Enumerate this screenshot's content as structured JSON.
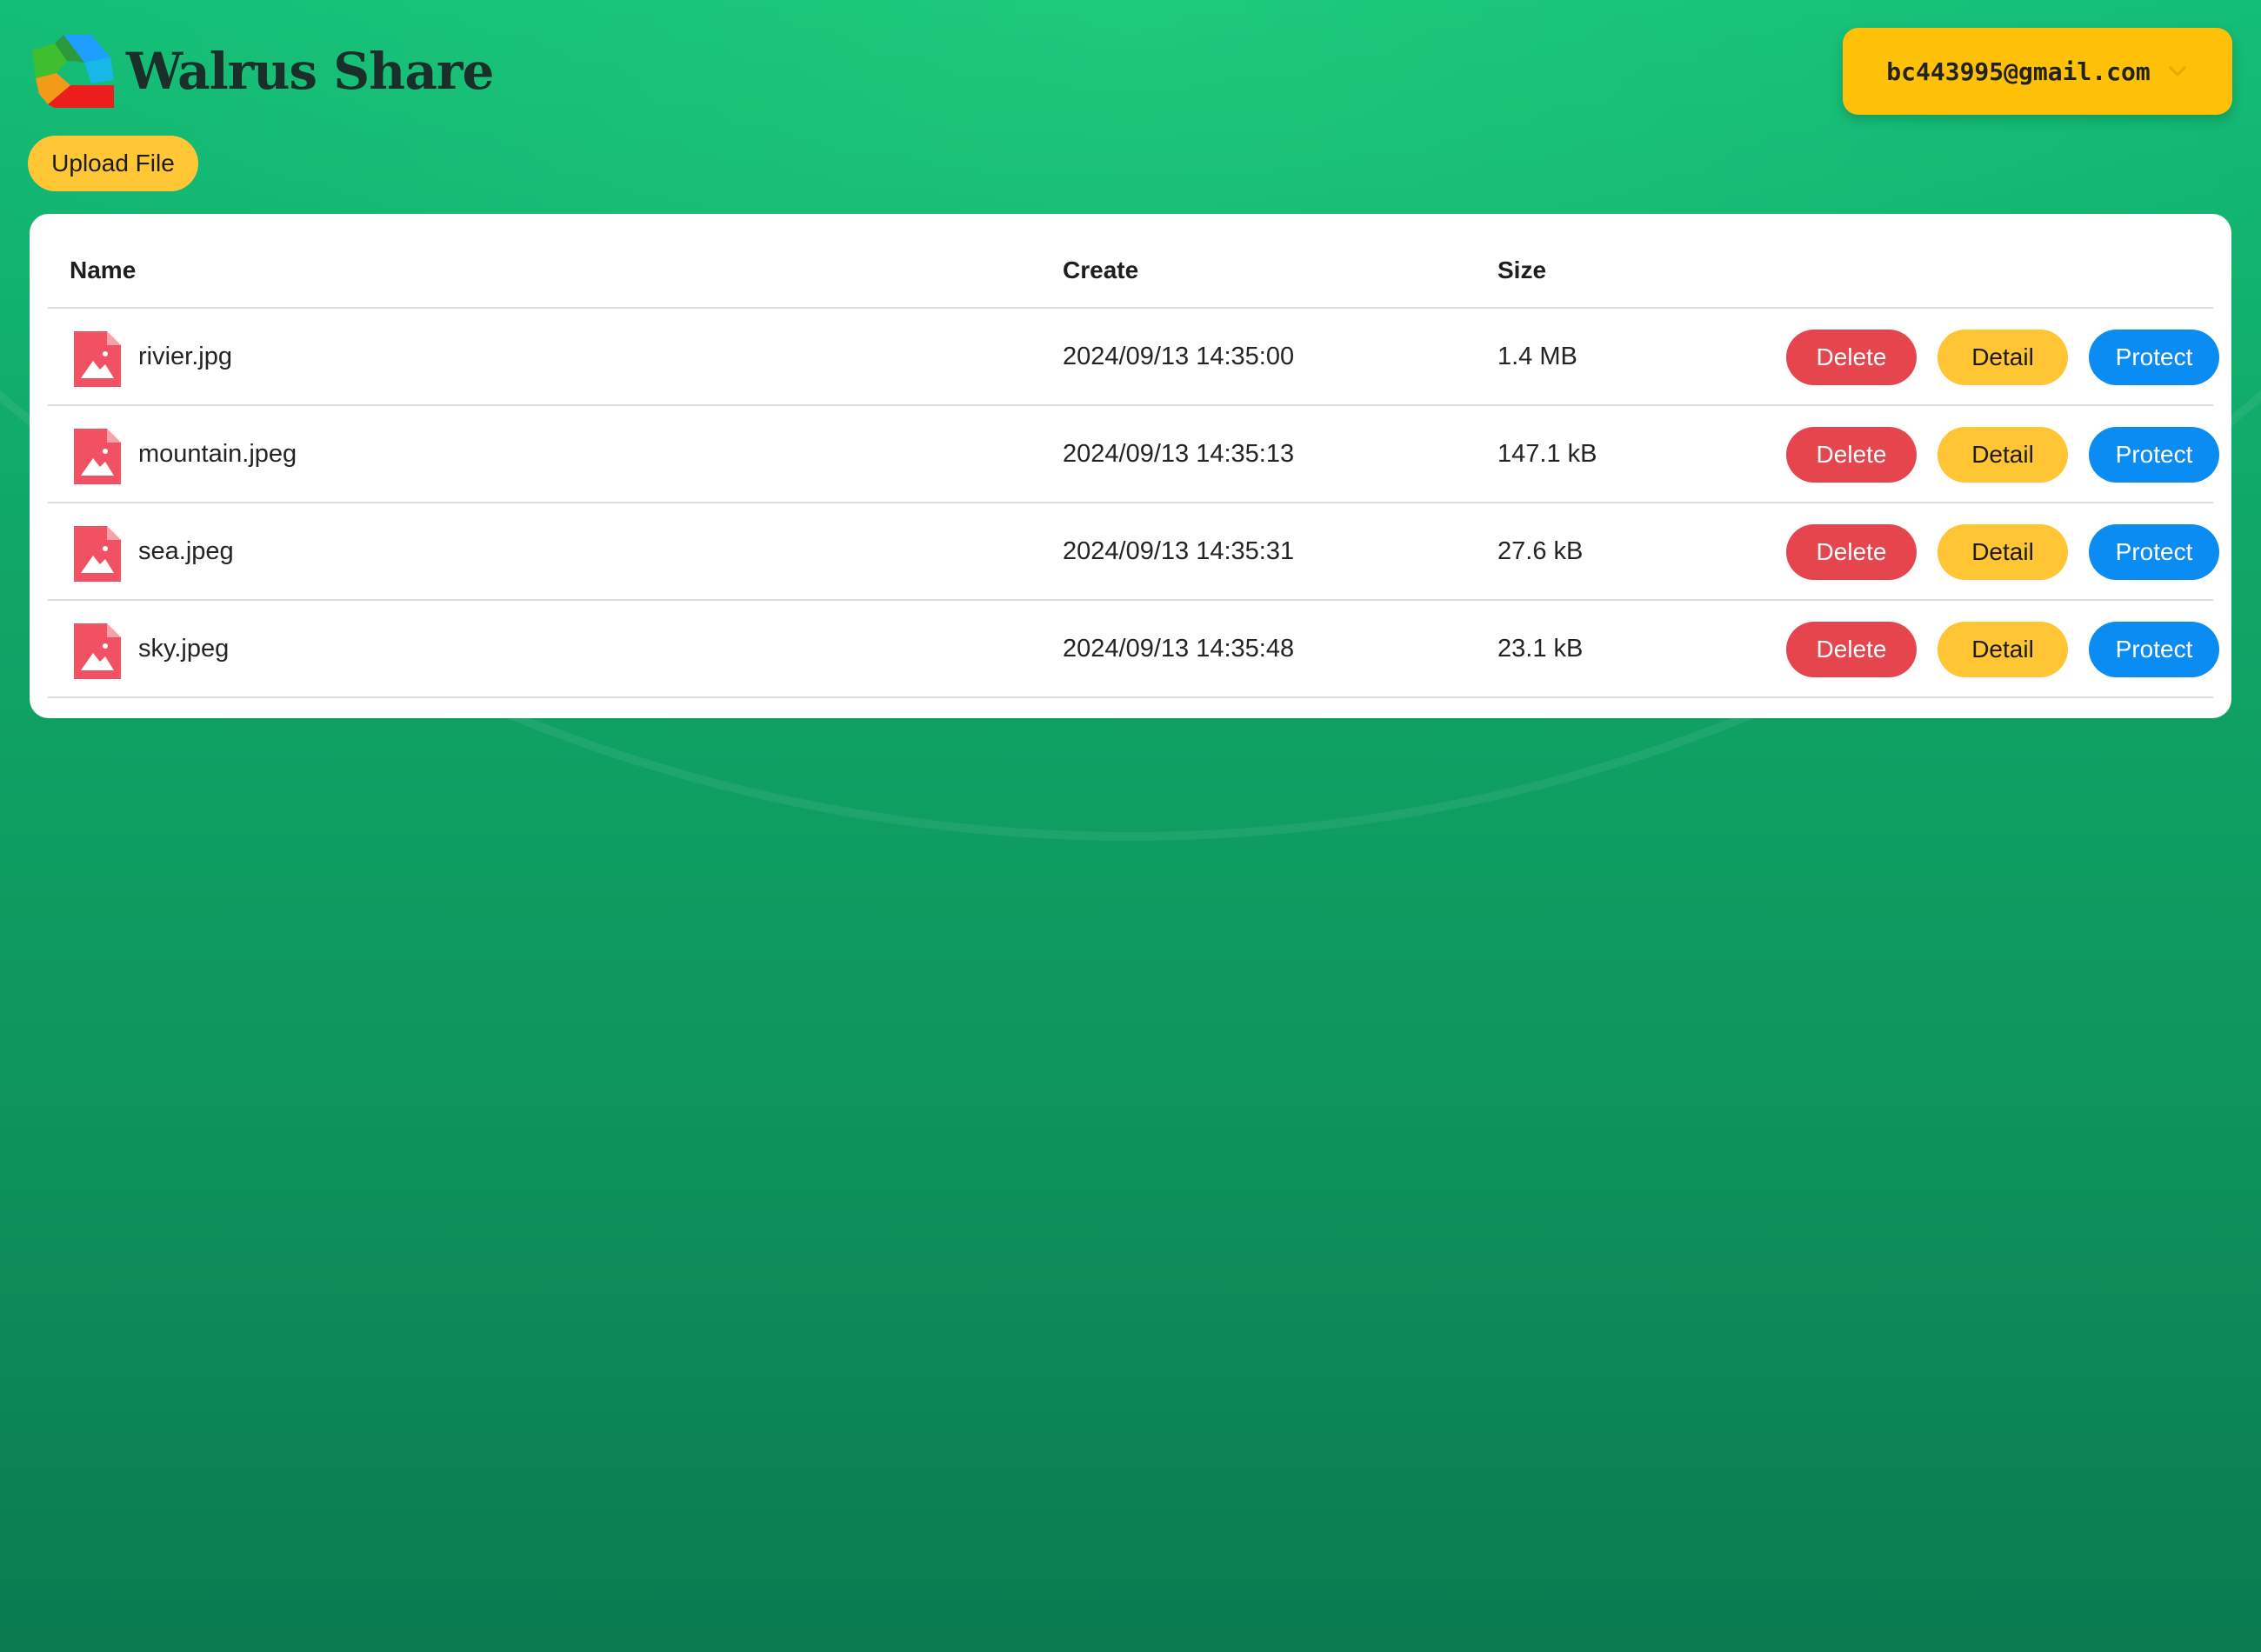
{
  "app": {
    "title": "Walrus Share",
    "logo_icon": "walrus-share-logo-icon"
  },
  "account": {
    "email": "bc443995@gmail.com",
    "dropdown_icon": "chevron-down-icon"
  },
  "toolbar": {
    "upload_label": "Upload File"
  },
  "table": {
    "columns": [
      "Name",
      "Create",
      "Size"
    ],
    "rows": [
      {
        "name": "rivier.jpg",
        "created": "2024/09/13 14:35:00",
        "size": "1.4 MB",
        "icon": "image-file-icon"
      },
      {
        "name": "mountain.jpeg",
        "created": "2024/09/13 14:35:13",
        "size": "147.1 kB",
        "icon": "image-file-icon"
      },
      {
        "name": "sea.jpeg",
        "created": "2024/09/13 14:35:31",
        "size": "27.6 kB",
        "icon": "image-file-icon"
      },
      {
        "name": "sky.jpeg",
        "created": "2024/09/13 14:35:48",
        "size": "23.1 kB",
        "icon": "image-file-icon"
      }
    ],
    "actions": {
      "delete_label": "Delete",
      "detail_label": "Detail",
      "protect_label": "Protect"
    }
  },
  "colors": {
    "background_top": "#13bd76",
    "background_bottom": "#0b7a50",
    "account_button": "#ffc107",
    "delete": "#e5454d",
    "detail": "#ffc535",
    "protect": "#0a8cf2",
    "file_icon": "#f25063"
  }
}
